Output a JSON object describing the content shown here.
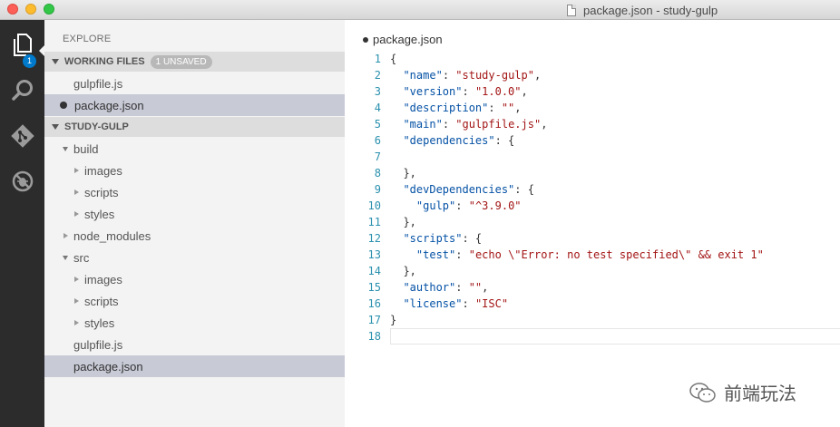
{
  "window": {
    "title": "package.json - study-gulp"
  },
  "activity_bar": {
    "items": [
      {
        "icon": "files-icon",
        "badge": "1"
      },
      {
        "icon": "search-icon"
      },
      {
        "icon": "git-icon"
      },
      {
        "icon": "debug-icon"
      }
    ]
  },
  "sidebar": {
    "title": "EXPLORE",
    "working_files": {
      "label": "WORKING FILES",
      "badge": "1 UNSAVED",
      "files": [
        "gulpfile.js",
        "package.json"
      ]
    },
    "project": {
      "label": "STUDY-GULP",
      "tree": [
        {
          "label": "build",
          "expanded": true
        },
        {
          "label": "images"
        },
        {
          "label": "scripts"
        },
        {
          "label": "styles"
        },
        {
          "label": "node_modules"
        },
        {
          "label": "src",
          "expanded": true
        },
        {
          "label": "images"
        },
        {
          "label": "scripts"
        },
        {
          "label": "styles"
        },
        {
          "label": "gulpfile.js"
        },
        {
          "label": "package.json"
        }
      ]
    }
  },
  "editor": {
    "tab_label": "package.json",
    "line_numbers": [
      "1",
      "2",
      "3",
      "4",
      "5",
      "6",
      "7",
      "8",
      "9",
      "10",
      "11",
      "12",
      "13",
      "14",
      "15",
      "16",
      "17",
      "18"
    ],
    "lines": [
      "{",
      "  \"name\": \"study-gulp\",",
      "  \"version\": \"1.0.0\",",
      "  \"description\": \"\",",
      "  \"main\": \"gulpfile.js\",",
      "  \"dependencies\": {",
      "",
      "  },",
      "  \"devDependencies\": {",
      "    \"gulp\": \"^3.9.0\"",
      "  },",
      "  \"scripts\": {",
      "    \"test\": \"echo \\\"Error: no test specified\\\" && exit 1\"",
      "  },",
      "  \"author\": \"\",",
      "  \"license\": \"ISC\"",
      "}",
      ""
    ]
  },
  "watermark": {
    "text": "前端玩法"
  }
}
